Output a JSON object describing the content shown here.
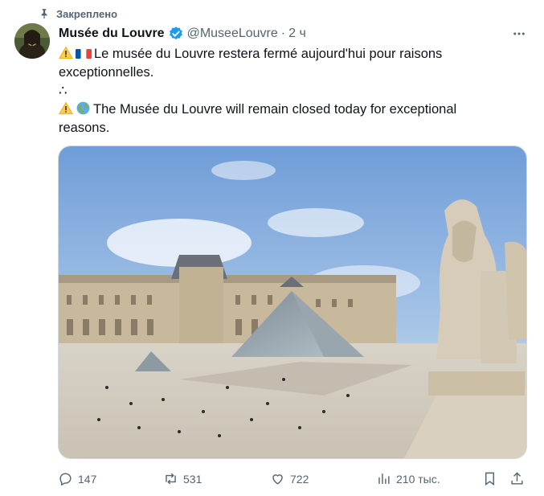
{
  "pinned_label": "Закреплено",
  "author": {
    "name": "Musée du Louvre",
    "handle": "@MuseeLouvre",
    "separator": "·",
    "time": "2 ч"
  },
  "tweet": {
    "line1": "Le musée du Louvre restera fermé aujourd'hui pour raisons exceptionnelles.",
    "separator": "∴",
    "line2": "The Musée du Louvre will remain closed today for exceptional reasons."
  },
  "stats": {
    "replies": "147",
    "reposts": "531",
    "likes": "722",
    "views": "210 тыс."
  },
  "colors": {
    "accent": "#1d9bf0",
    "muted": "#536471"
  }
}
